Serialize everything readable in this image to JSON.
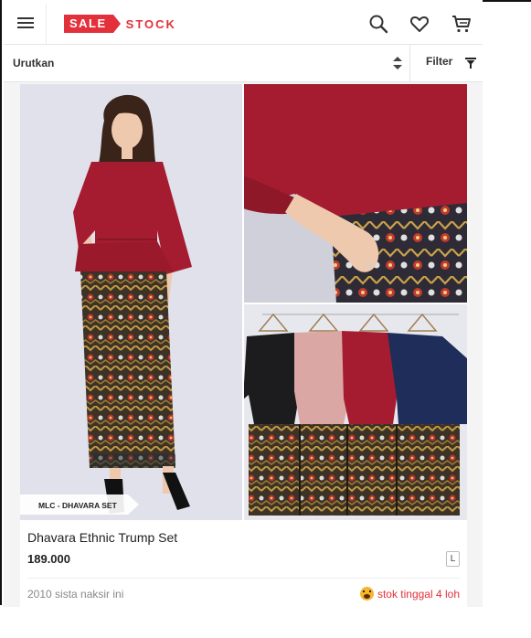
{
  "header": {
    "brand_sale": "SALE",
    "brand_stock": "STOCK",
    "icons": [
      "menu-icon",
      "search-icon",
      "heart-icon",
      "cart-icon"
    ]
  },
  "sortbar": {
    "sort_label": "Urutkan",
    "filter_label": "Filter"
  },
  "product": {
    "tag": "MLC - DHAVARA SET",
    "title": "Dhavara Ethnic Trump Set",
    "price": "189.000",
    "size": "L",
    "likes": "2010 sista naksir ini",
    "stock_note": "stok tinggal 4 loh"
  },
  "colors": {
    "brand": "#e2313b",
    "top_red": "#a51c30",
    "skirt": "#5b4a2e",
    "background": "#f4f4f4"
  }
}
